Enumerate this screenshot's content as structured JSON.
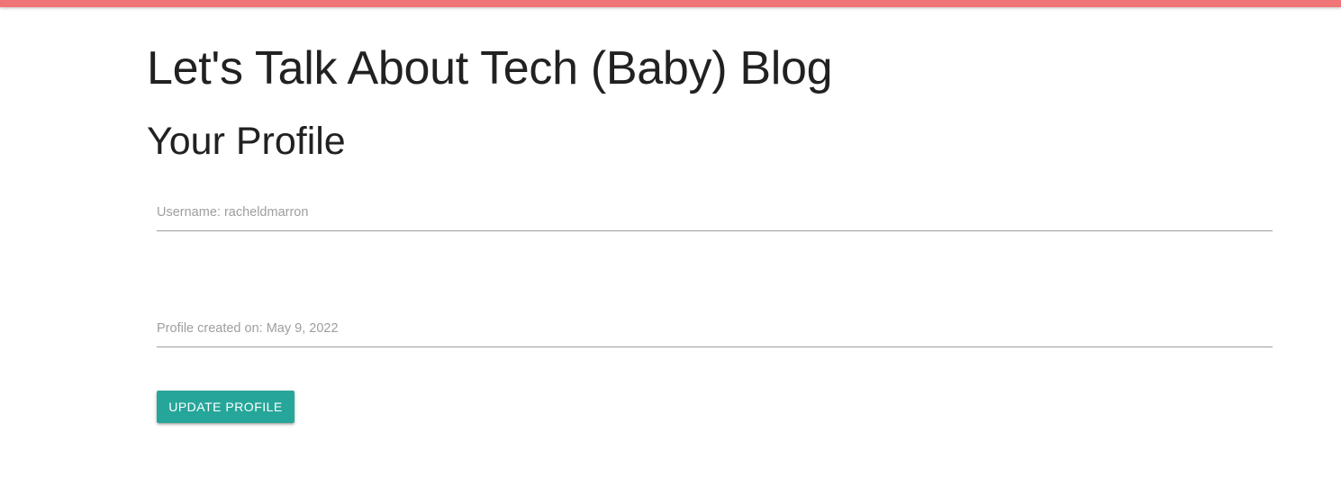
{
  "header": {
    "accent_color": "#ef7576"
  },
  "blog": {
    "title": "Let's Talk About Tech (Baby) Blog"
  },
  "profile": {
    "heading": "Your Profile",
    "username_label": "Username: racheldmarron",
    "created_label": "Profile created on: May 9, 2022",
    "update_button_label": "UPDATE PROFILE",
    "button_color": "#26a69a"
  }
}
